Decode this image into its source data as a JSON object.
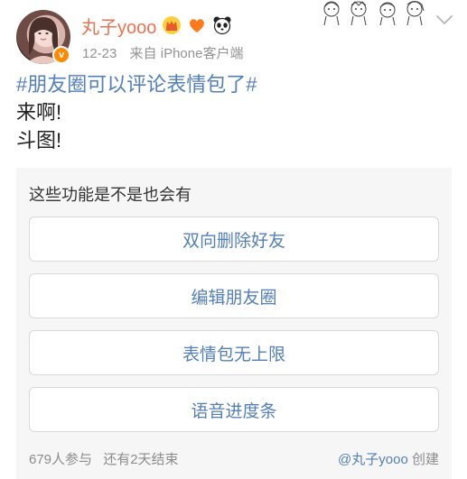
{
  "header": {
    "username": "丸子yooo",
    "verified_mark": "v",
    "post_time": "12-23",
    "source_prefix": "来自",
    "source_device": "iPhone客户端",
    "icons": [
      "avatar",
      "verified-badge-icon",
      "crown-icon",
      "orange-heart-icon",
      "panda-icon",
      "anime-doodle-decoration",
      "chevron-down-icon"
    ]
  },
  "post": {
    "hashtag": "#朋友圈可以评论表情包了#",
    "line1": "来啊!",
    "line2": "斗图!"
  },
  "poll": {
    "question": "这些功能是不是也会有",
    "options": [
      "双向删除好友",
      "编辑朋友圈",
      "表情包无上限",
      "语音进度条"
    ],
    "participants": "679人参与",
    "ends": "还有2天结束",
    "creator_link": "@丸子yooo",
    "creator_suffix": "创建"
  },
  "colors": {
    "username": "#eb7350",
    "link": "#5380b8",
    "meta": "#939393",
    "card_bg": "#f6f6f6"
  }
}
